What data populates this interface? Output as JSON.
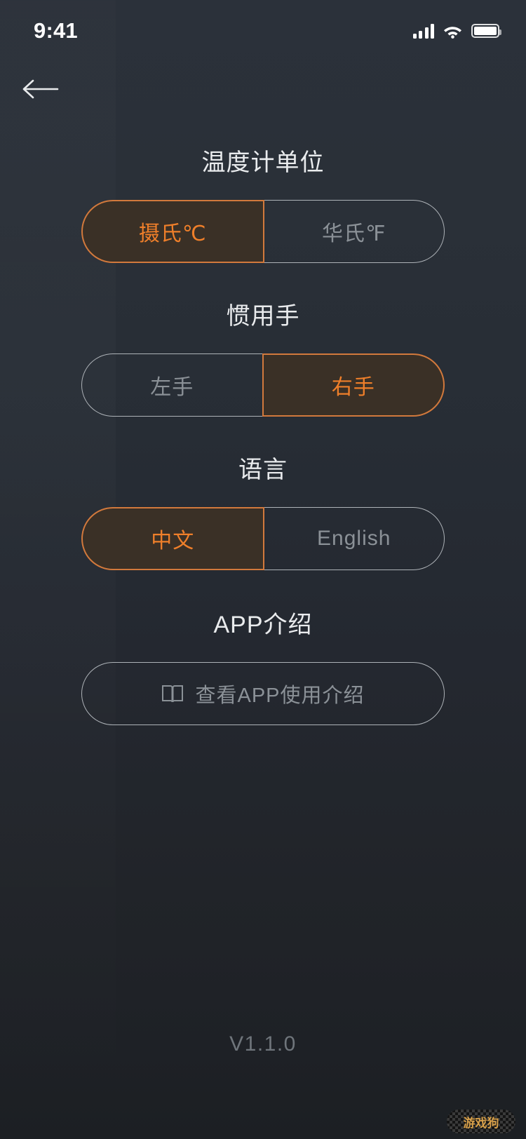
{
  "status_bar": {
    "time": "9:41",
    "signal_icon": "signal-bars-icon",
    "wifi_icon": "wifi-icon",
    "battery_icon": "battery-full-icon"
  },
  "nav": {
    "back_icon": "back-arrow-icon"
  },
  "sections": {
    "temperature": {
      "title": "温度计单位",
      "options": [
        {
          "label": "摄氏℃",
          "selected": true
        },
        {
          "label": "华氏℉",
          "selected": false
        }
      ]
    },
    "handedness": {
      "title": "惯用手",
      "options": [
        {
          "label": "左手",
          "selected": false
        },
        {
          "label": "右手",
          "selected": true
        }
      ]
    },
    "language": {
      "title": "语言",
      "options": [
        {
          "label": "中文",
          "selected": true
        },
        {
          "label": "English",
          "selected": false
        }
      ]
    },
    "app_intro": {
      "title": "APP介绍",
      "button_label": "查看APP使用介绍",
      "button_icon": "open-book-icon"
    }
  },
  "footer": {
    "version": "V1.1.0",
    "watermark": "游戏狗"
  },
  "colors": {
    "accent": "#ef7f2a",
    "accent_border": "#d2793c",
    "accent_fill": "#3a3026",
    "inactive_text": "#8b9197",
    "inactive_border": "#aeb3b8",
    "title_text": "#e9ebed",
    "background_top": "#2b313a",
    "background_bottom": "#1c1f23"
  }
}
